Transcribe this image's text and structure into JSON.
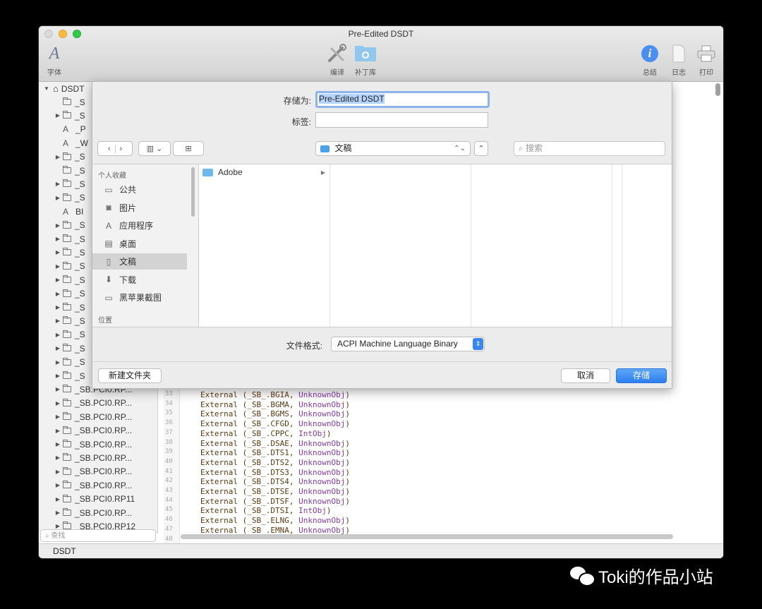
{
  "window": {
    "title": "Pre-Edited DSDT"
  },
  "toolbar": {
    "font_label": "字体",
    "compile_label": "编译",
    "patch_label": "补丁库",
    "summary_label": "总结",
    "log_label": "日志",
    "print_label": "打印"
  },
  "sidebar": {
    "root_label": "DSDT",
    "rows": [
      {
        "label": "_S",
        "kind": "folder",
        "expand": false
      },
      {
        "label": "_S",
        "kind": "folder",
        "expand": true
      },
      {
        "label": "_P",
        "kind": "method",
        "expand": false
      },
      {
        "label": "_W",
        "kind": "method",
        "expand": false
      },
      {
        "label": "_S",
        "kind": "folder",
        "expand": true
      },
      {
        "label": "_S",
        "kind": "folder",
        "expand": false
      },
      {
        "label": "_S",
        "kind": "folder",
        "expand": true
      },
      {
        "label": "_S",
        "kind": "folder",
        "expand": true
      },
      {
        "label": "BI",
        "kind": "method",
        "expand": false
      },
      {
        "label": "_S",
        "kind": "folder",
        "expand": true
      },
      {
        "label": "_S",
        "kind": "folder",
        "expand": true
      },
      {
        "label": "_S",
        "kind": "folder",
        "expand": true
      },
      {
        "label": "_S",
        "kind": "folder",
        "expand": true
      },
      {
        "label": "_S",
        "kind": "folder",
        "expand": true
      },
      {
        "label": "_S",
        "kind": "folder",
        "expand": true
      },
      {
        "label": "_S",
        "kind": "folder",
        "expand": true
      },
      {
        "label": "_S",
        "kind": "folder",
        "expand": true
      },
      {
        "label": "_S",
        "kind": "folder",
        "expand": true
      },
      {
        "label": "_S",
        "kind": "folder",
        "expand": true
      },
      {
        "label": "_S",
        "kind": "folder",
        "expand": true
      },
      {
        "label": "_S",
        "kind": "folder",
        "expand": true
      },
      {
        "label": "_SB.PCI0.RP...",
        "kind": "folder",
        "expand": true
      },
      {
        "label": "_SB.PCI0.RP...",
        "kind": "folder",
        "expand": true
      },
      {
        "label": "_SB.PCI0.RP...",
        "kind": "folder",
        "expand": true
      },
      {
        "label": "_SB.PCI0.RP...",
        "kind": "folder",
        "expand": true
      },
      {
        "label": "_SB.PCI0.RP...",
        "kind": "folder",
        "expand": true
      },
      {
        "label": "_SB.PCI0.RP...",
        "kind": "folder",
        "expand": true
      },
      {
        "label": "_SB.PCI0.RP...",
        "kind": "folder",
        "expand": true
      },
      {
        "label": "_SB.PCI0.RP...",
        "kind": "folder",
        "expand": true
      },
      {
        "label": "_SB.PCI0.RP11",
        "kind": "folder",
        "expand": true
      },
      {
        "label": "_SB.PCI0.RP...",
        "kind": "folder",
        "expand": true
      },
      {
        "label": "_SB.PCI0.RP12",
        "kind": "folder",
        "expand": true
      }
    ],
    "search_placeholder": "查找"
  },
  "editor": {
    "lines": [
      {
        "n": "33",
        "name": "_SB_.BGIA",
        "type": "UnknownObj"
      },
      {
        "n": "34",
        "name": "_SB_.BGMA",
        "type": "UnknownObj"
      },
      {
        "n": "35",
        "name": "_SB_.BGMS",
        "type": "UnknownObj"
      },
      {
        "n": "36",
        "name": "_SB_.CFGD",
        "type": "UnknownObj"
      },
      {
        "n": "37",
        "name": "_SB_.CPPC",
        "type": "IntObj"
      },
      {
        "n": "38",
        "name": "_SB_.DSAE",
        "type": "UnknownObj"
      },
      {
        "n": "39",
        "name": "_SB_.DTS1",
        "type": "UnknownObj"
      },
      {
        "n": "40",
        "name": "_SB_.DTS2",
        "type": "UnknownObj"
      },
      {
        "n": "41",
        "name": "_SB_.DTS3",
        "type": "UnknownObj"
      },
      {
        "n": "42",
        "name": "_SB_.DTS4",
        "type": "UnknownObj"
      },
      {
        "n": "43",
        "name": "_SB_.DTSE",
        "type": "UnknownObj"
      },
      {
        "n": "44",
        "name": "_SB_.DTSF",
        "type": "UnknownObj"
      },
      {
        "n": "45",
        "name": "_SB_.DTSI",
        "type": "IntObj"
      },
      {
        "n": "46",
        "name": "_SB_.ELNG",
        "type": "UnknownObj"
      },
      {
        "n": "47",
        "name": "_SB_.EMNA",
        "type": "UnknownObj"
      },
      {
        "n": "48",
        "name": "",
        "type": ""
      }
    ],
    "keyword": "External"
  },
  "status": {
    "text": "DSDT"
  },
  "save_sheet": {
    "save_as_label": "存储为:",
    "save_as_value": "Pre-Edited DSDT",
    "tags_label": "标签:",
    "tags_value": "",
    "location": "文稿",
    "search_placeholder": "搜索",
    "favorites_header": "个人收藏",
    "favorites": [
      {
        "label": "公共",
        "icon": "folder-icon"
      },
      {
        "label": "图片",
        "icon": "camera-icon"
      },
      {
        "label": "应用程序",
        "icon": "apps-icon"
      },
      {
        "label": "桌面",
        "icon": "desktop-icon"
      },
      {
        "label": "文稿",
        "icon": "documents-icon"
      },
      {
        "label": "下载",
        "icon": "download-icon"
      },
      {
        "label": "黑苹果截图",
        "icon": "folder-icon"
      }
    ],
    "active_favorite": 4,
    "locations_header": "位置",
    "files": [
      {
        "label": "Adobe",
        "icon": "folder-icon",
        "has_children": true
      }
    ],
    "format_label": "文件格式:",
    "format_value": "ACPI Machine Language Binary",
    "new_folder_label": "新建文件夹",
    "cancel_label": "取消",
    "save_label": "存储"
  },
  "watermark": {
    "text": "Toki的作品小站"
  },
  "colors": {
    "accent": "#2d7ff0",
    "focus_ring": "#8cb3ea",
    "keyword": "#5e3b10",
    "type": "#8a3cb0"
  }
}
